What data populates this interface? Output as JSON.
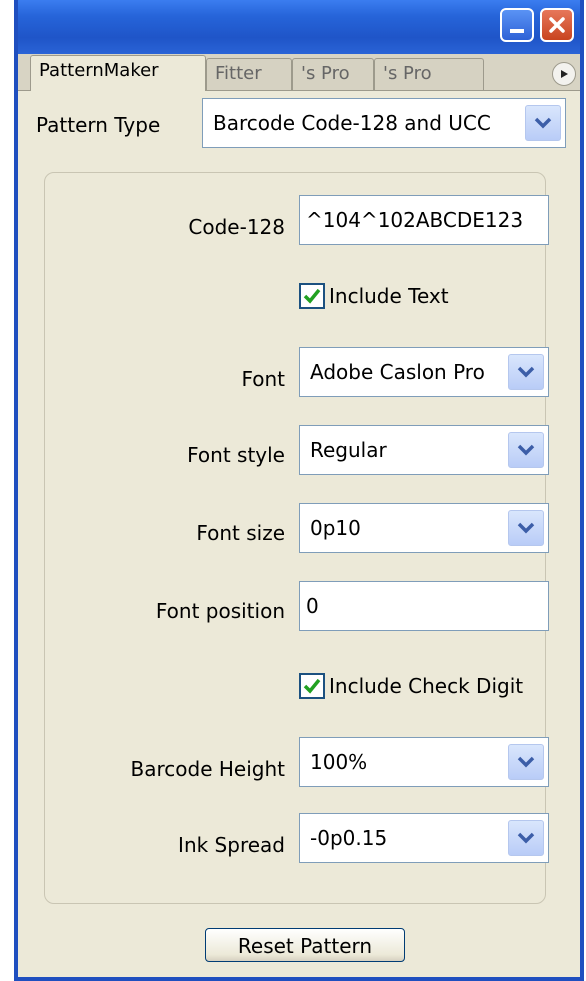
{
  "tabs": [
    {
      "label": "PatternMaker"
    },
    {
      "label": "Fitter"
    },
    {
      "label": "'s Pro"
    },
    {
      "label": "'s Pro"
    }
  ],
  "pattern_type": {
    "label": "Pattern Type",
    "value": "Barcode Code-128 and UCC"
  },
  "fields": {
    "code128": {
      "label": "Code-128",
      "value": "^104^102ABCDE123"
    },
    "include_text": {
      "label": "Include Text",
      "checked": true
    },
    "font": {
      "label": "Font",
      "value": "Adobe Caslon Pro"
    },
    "font_style": {
      "label": "Font style",
      "value": "Regular"
    },
    "font_size": {
      "label": "Font size",
      "value": "0p10"
    },
    "font_position": {
      "label": "Font position",
      "value": "0"
    },
    "include_check_digit": {
      "label": "Include Check Digit",
      "checked": true
    },
    "barcode_height": {
      "label": "Barcode Height",
      "value": "100%"
    },
    "ink_spread": {
      "label": "Ink Spread",
      "value": "-0p0.15"
    }
  },
  "reset_button": {
    "label": "Reset Pattern"
  },
  "colors": {
    "titlebar": "#2664d9",
    "panel": "#ece9d8",
    "border": "#7f9db9",
    "check": "#21a121"
  }
}
